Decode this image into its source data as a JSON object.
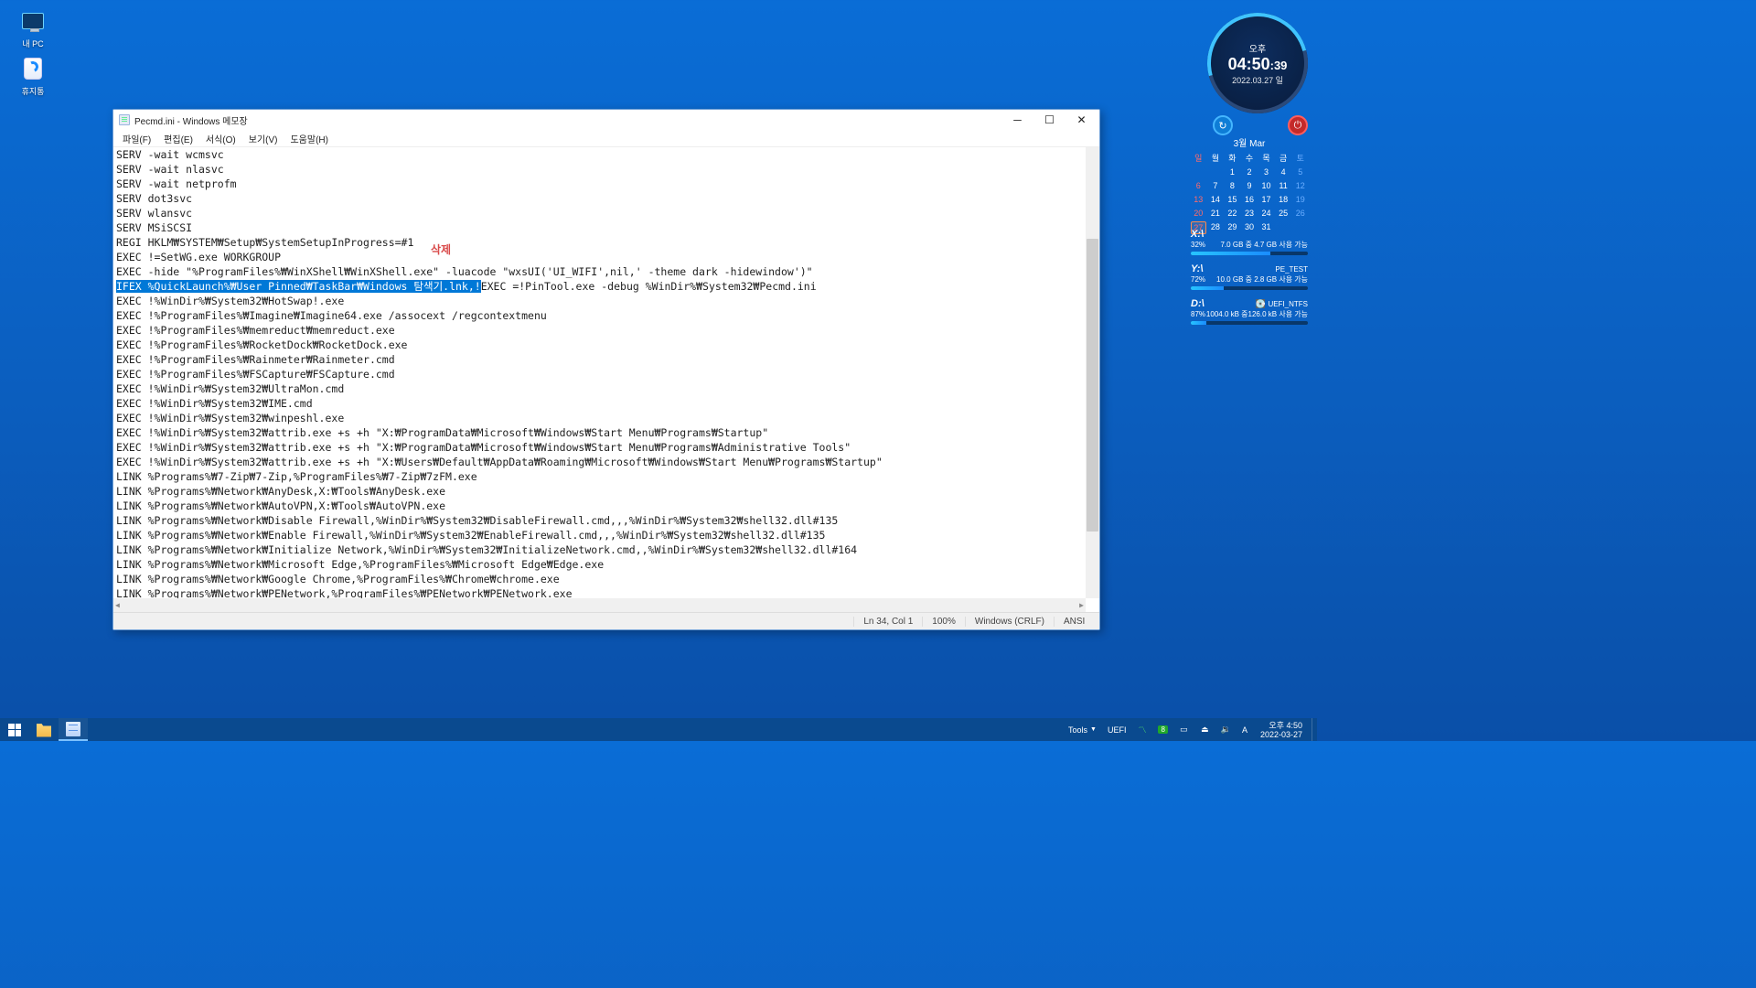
{
  "desktop": {
    "pc_label": "내 PC",
    "trash_label": "휴지통"
  },
  "window": {
    "title": "Pecmd.ini - Windows 메모장",
    "menu": {
      "file": "파일(F)",
      "edit": "편집(E)",
      "format": "서식(O)",
      "view": "보기(V)",
      "help": "도움말(H)"
    },
    "annotation": "삭제",
    "lines": [
      "SERV -wait wcmsvc",
      "SERV -wait nlasvc",
      "SERV -wait netprofm",
      "SERV dot3svc",
      "SERV wlansvc",
      "SERV MSiSCSI",
      "REGI HKLM\\SYSTEM\\Setup\\SystemSetupInProgress=#1",
      "EXEC !=SetWG.exe WORKGROUP",
      "EXEC -hide \"%ProgramFiles%\\WinXShell\\WinXShell.exe\" -luacode \"wxsUI('UI_WIFI',nil,' -theme dark -hidewindow')\"",
      {
        "highlight": "IFEX %QuickLaunch%\\User Pinned\\TaskBar\\Windows 탐색기.lnk,!",
        "rest": "EXEC =!PinTool.exe -debug %WinDir%\\System32\\Pecmd.ini"
      },
      "EXEC !%WinDir%\\System32\\HotSwap!.exe",
      "EXEC !%ProgramFiles%\\Imagine\\Imagine64.exe /assocext /regcontextmenu",
      "EXEC !%ProgramFiles%\\memreduct\\memreduct.exe",
      "EXEC !%ProgramFiles%\\RocketDock\\RocketDock.exe",
      "EXEC !%ProgramFiles%\\Rainmeter\\Rainmeter.cmd",
      "EXEC !%ProgramFiles%\\FSCapture\\FSCapture.cmd",
      "EXEC !%WinDir%\\System32\\UltraMon.cmd",
      "EXEC !%WinDir%\\System32\\IME.cmd",
      "EXEC !%WinDir%\\System32\\winpeshl.exe",
      "EXEC !%WinDir%\\System32\\attrib.exe +s +h \"X:\\ProgramData\\Microsoft\\Windows\\Start Menu\\Programs\\Startup\"",
      "EXEC !%WinDir%\\System32\\attrib.exe +s +h \"X:\\ProgramData\\Microsoft\\Windows\\Start Menu\\Programs\\Administrative Tools\"",
      "EXEC !%WinDir%\\System32\\attrib.exe +s +h \"X:\\Users\\Default\\AppData\\Roaming\\Microsoft\\Windows\\Start Menu\\Programs\\Startup\"",
      "LINK %Programs%\\7-Zip\\7-Zip,%ProgramFiles%\\7-Zip\\7zFM.exe",
      "LINK %Programs%\\Network\\AnyDesk,X:\\Tools\\AnyDesk.exe",
      "LINK %Programs%\\Network\\AutoVPN,X:\\Tools\\AutoVPN.exe",
      "LINK %Programs%\\Network\\Disable Firewall,%WinDir%\\System32\\DisableFirewall.cmd,,,%WinDir%\\System32\\shell32.dll#135",
      "LINK %Programs%\\Network\\Enable Firewall,%WinDir%\\System32\\EnableFirewall.cmd,,,%WinDir%\\System32\\shell32.dll#135",
      "LINK %Programs%\\Network\\Initialize Network,%WinDir%\\System32\\InitializeNetwork.cmd,,%WinDir%\\System32\\shell32.dll#164",
      "LINK %Programs%\\Network\\Microsoft Edge,%ProgramFiles%\\Microsoft Edge\\Edge.exe",
      "LINK %Programs%\\Network\\Google Chrome,%ProgramFiles%\\Chrome\\chrome.exe",
      "LINK %Programs%\\Network\\PENetwork,%ProgramFiles%\\PENetwork\\PENetwork.exe"
    ],
    "status": {
      "pos": "Ln 34, Col 1",
      "zoom": "100%",
      "eol": "Windows (CRLF)",
      "enc": "ANSI"
    }
  },
  "clock": {
    "ampm": "오후",
    "hhmm": "04:50",
    "ss": ":39",
    "date": "2022.03.27 일"
  },
  "calendar": {
    "title": "3월 Mar",
    "dows": [
      "일",
      "월",
      "화",
      "수",
      "목",
      "금",
      "토"
    ],
    "days": [
      {
        "d": "",
        "t": "blank"
      },
      {
        "d": "",
        "t": "blank"
      },
      {
        "d": "1",
        "t": ""
      },
      {
        "d": "2",
        "t": ""
      },
      {
        "d": "3",
        "t": ""
      },
      {
        "d": "4",
        "t": ""
      },
      {
        "d": "5",
        "t": "sat"
      },
      {
        "d": "6",
        "t": "sun"
      },
      {
        "d": "7",
        "t": ""
      },
      {
        "d": "8",
        "t": ""
      },
      {
        "d": "9",
        "t": ""
      },
      {
        "d": "10",
        "t": ""
      },
      {
        "d": "11",
        "t": ""
      },
      {
        "d": "12",
        "t": "sat"
      },
      {
        "d": "13",
        "t": "sun"
      },
      {
        "d": "14",
        "t": ""
      },
      {
        "d": "15",
        "t": ""
      },
      {
        "d": "16",
        "t": ""
      },
      {
        "d": "17",
        "t": ""
      },
      {
        "d": "18",
        "t": ""
      },
      {
        "d": "19",
        "t": "sat"
      },
      {
        "d": "20",
        "t": "sun"
      },
      {
        "d": "21",
        "t": ""
      },
      {
        "d": "22",
        "t": ""
      },
      {
        "d": "23",
        "t": ""
      },
      {
        "d": "24",
        "t": ""
      },
      {
        "d": "25",
        "t": ""
      },
      {
        "d": "26",
        "t": "sat"
      },
      {
        "d": "27",
        "t": "sun today"
      },
      {
        "d": "28",
        "t": ""
      },
      {
        "d": "29",
        "t": ""
      },
      {
        "d": "30",
        "t": ""
      },
      {
        "d": "31",
        "t": ""
      },
      {
        "d": "",
        "t": "blank"
      },
      {
        "d": "",
        "t": "blank"
      }
    ]
  },
  "drives": [
    {
      "letter": "X:\\",
      "pct": "32%",
      "fill": 68,
      "label": "7.0 GB 중   4.7 GB 사용 가능",
      "icon": "win"
    },
    {
      "letter": "Y:\\",
      "pct": "72%",
      "fill": 28,
      "label": "10.0 GB 중   2.8 GB 사용 가능",
      "name": "PE_TEST",
      "icon": "win"
    },
    {
      "letter": "D:\\",
      "pct": "87%",
      "fill": 13,
      "label": "1004.0 kB 중126.0 kB 사용 가능",
      "name": "UEFI_NTFS",
      "icon": "disk"
    }
  ],
  "taskbar": {
    "tools": "Tools",
    "uefi": "UEFI",
    "ime": "A",
    "net_badge": "8",
    "clock_top": "오후 4:50",
    "clock_bot": "2022-03-27"
  }
}
